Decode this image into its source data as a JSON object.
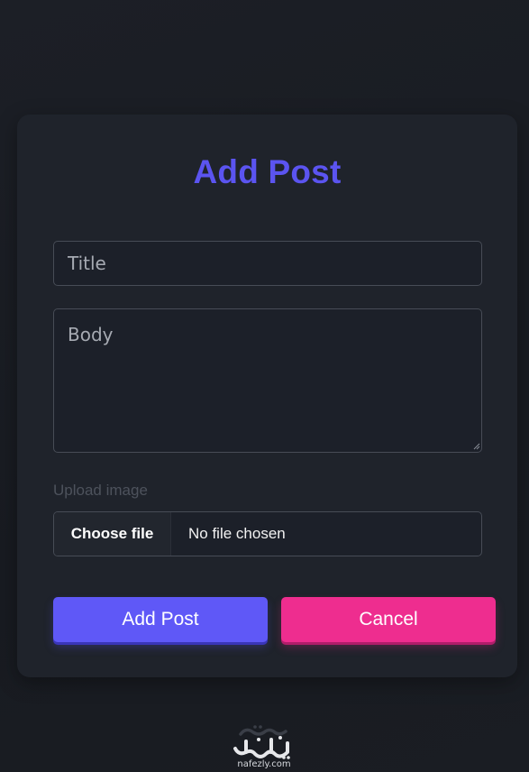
{
  "form": {
    "title": "Add Post",
    "title_placeholder": "Title",
    "body_placeholder": "Body",
    "upload_label": "Upload image",
    "choose_file_label": "Choose file",
    "file_status": "No file chosen",
    "submit_label": "Add Post",
    "cancel_label": "Cancel"
  },
  "watermark": {
    "url": "nafezly.com"
  },
  "colors": {
    "accent": "#5b54f0",
    "submit": "#5f58f7",
    "cancel": "#ee2d8f",
    "card": "#1f232b",
    "background": "#1a1d23"
  }
}
